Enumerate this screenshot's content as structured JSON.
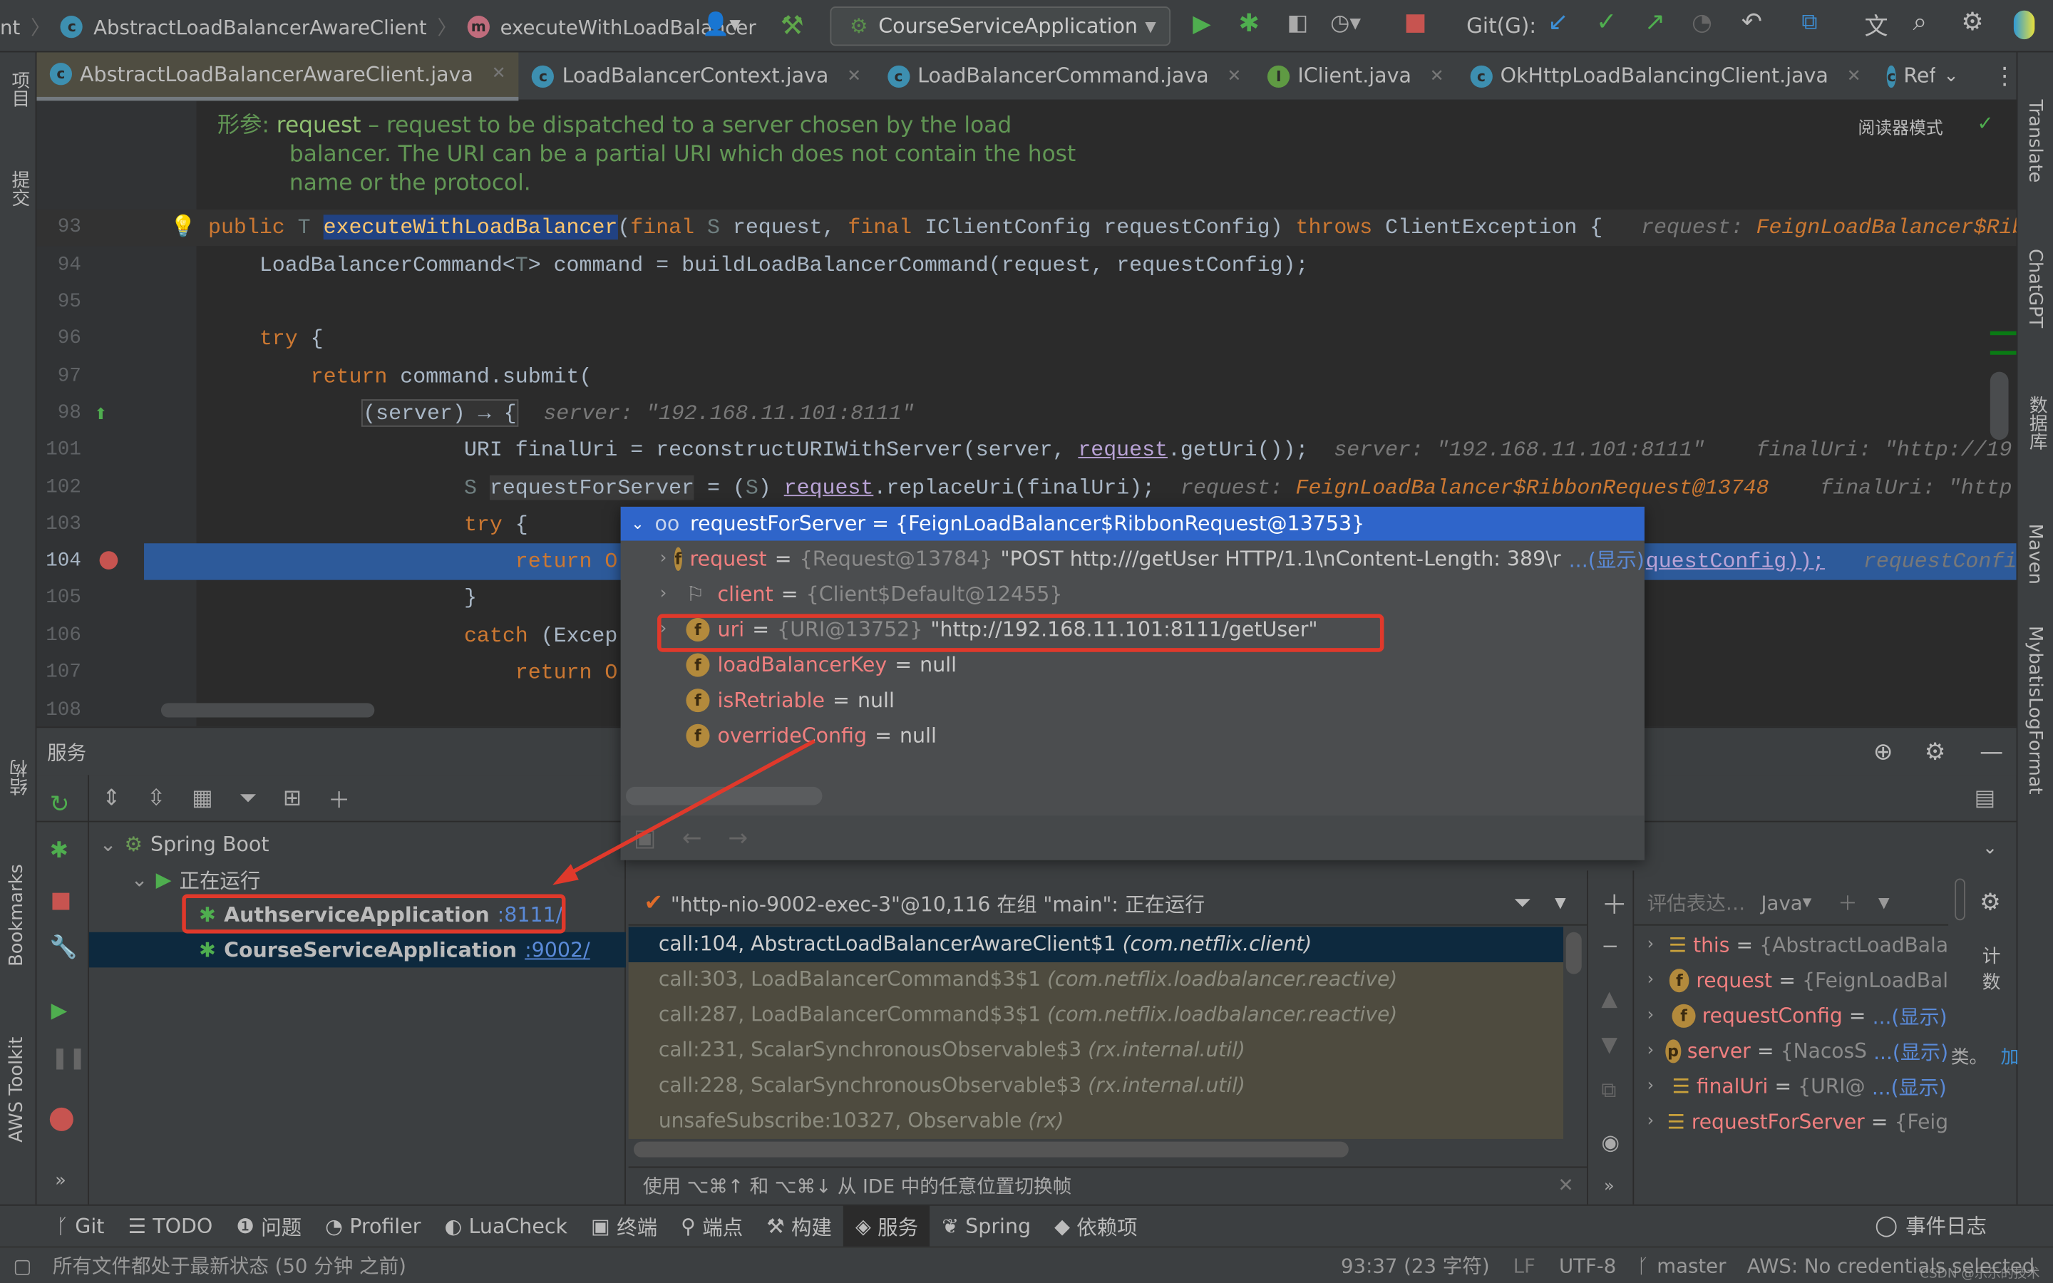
{
  "toolbar": {
    "breadcrumb": [
      "nt",
      "AbstractLoadBalancerAwareClient",
      "executeWithLoadBalancer"
    ],
    "run_config": "CourseServiceApplication",
    "git_label": "Git(G):"
  },
  "tabs": [
    {
      "label": "AbstractLoadBalancerAwareClient.java",
      "icon": "C",
      "active": true
    },
    {
      "label": "LoadBalancerContext.java",
      "icon": "C"
    },
    {
      "label": "LoadBalancerCommand.java",
      "icon": "C"
    },
    {
      "label": "IClient.java",
      "icon": "I"
    },
    {
      "label": "OkHttpLoadBalancingClient.java",
      "icon": "C"
    },
    {
      "label": "ReflectiveFeign",
      "icon": "C"
    }
  ],
  "left_stripe": {
    "project": "项目",
    "commit": "提交",
    "structure": "结构",
    "bookmarks": "Bookmarks",
    "aws": "AWS Toolkit"
  },
  "right_stripe": {
    "translate": "Translate",
    "chatgpt": "ChatGPT",
    "database": "数据库",
    "maven": "Maven",
    "mybatis": "MybatisLogFormat"
  },
  "editor": {
    "reader_mode": "阅读器模式",
    "doc": {
      "label": "形参:",
      "param": "request",
      "line1": " – request to be dispatched to a server chosen by the load",
      "line2": "balancer. The URI can be a partial URI which does not contain the host",
      "line3": "name or the protocol."
    },
    "lines": [
      {
        "n": "93",
        "t": [
          [
            "public ",
            "k"
          ],
          [
            "T ",
            "tp"
          ],
          [
            "executeWithLoadBalancer",
            "mh"
          ],
          [
            "(",
            ""
          ],
          [
            "final ",
            "k"
          ],
          [
            "S ",
            "tp"
          ],
          [
            "request, ",
            ""
          ],
          [
            "final ",
            "k"
          ],
          [
            "IClientConfig requestConfig) ",
            ""
          ],
          [
            "throws ",
            "k"
          ],
          [
            "ClientException {",
            ""
          ],
          [
            "   request: ",
            "hint"
          ],
          [
            "FeignLoadBalancer$Ribbo",
            "hinto"
          ]
        ]
      },
      {
        "n": "94",
        "t": [
          [
            "    LoadBalancerCommand<",
            ""
          ],
          [
            "T",
            "tp"
          ],
          [
            "> command = buildLoadBalancerCommand(request, requestConfig);",
            ""
          ]
        ]
      },
      {
        "n": "95",
        "t": []
      },
      {
        "n": "96",
        "t": [
          [
            "    ",
            ""
          ],
          [
            "try ",
            "k"
          ],
          [
            "{",
            ""
          ]
        ]
      },
      {
        "n": "97",
        "t": [
          [
            "        ",
            ""
          ],
          [
            "return ",
            "k"
          ],
          [
            "command.submit(",
            ""
          ]
        ]
      },
      {
        "n": "98",
        "t": [
          [
            "            ",
            ""
          ],
          [
            "(server) → {",
            "lb"
          ],
          [
            "  server: \"192.168.11.101:8111\"",
            "hint"
          ]
        ]
      },
      {
        "n": "101",
        "t": [
          [
            "                    URI finalUri = reconstructURIWithServer(server, ",
            ""
          ],
          [
            "request",
            "ul"
          ],
          [
            ".getUri());",
            ""
          ],
          [
            "  server: \"192.168.11.101:8111\"    finalUri: \"http://19",
            "hint"
          ]
        ]
      },
      {
        "n": "102",
        "t": [
          [
            "                    ",
            ""
          ],
          [
            "S ",
            "tp"
          ],
          [
            "requestForServer",
            "hv"
          ],
          [
            " = (",
            ""
          ],
          [
            "S",
            "tp"
          ],
          [
            ") ",
            ""
          ],
          [
            "request",
            "ul"
          ],
          [
            ".replaceUri(finalUri);",
            ""
          ],
          [
            "  request: ",
            "hint"
          ],
          [
            "FeignLoadBalancer$RibbonRequest@13748",
            "hinto"
          ],
          [
            "    finalUri: \"http",
            "hint"
          ]
        ]
      },
      {
        "n": "103",
        "t": [
          [
            "                    ",
            ""
          ],
          [
            "try ",
            "k"
          ],
          [
            "{",
            ""
          ]
        ]
      },
      {
        "n": "104",
        "t": [
          [
            "                        ",
            ""
          ],
          [
            "return O",
            "k"
          ]
        ]
      },
      {
        "n": "105",
        "t": [
          [
            "                    }",
            ""
          ]
        ]
      },
      {
        "n": "106",
        "t": [
          [
            "                    ",
            ""
          ],
          [
            "catch ",
            "k"
          ],
          [
            "(Excep",
            ""
          ]
        ]
      },
      {
        "n": "107",
        "t": [
          [
            "                        ",
            ""
          ],
          [
            "return O",
            "k"
          ]
        ]
      },
      {
        "n": "108",
        "t": []
      }
    ],
    "line104_tail": "questConfig));",
    "line104_hint": "requestConfig"
  },
  "popup": {
    "header": "requestForServer = {FeignLoadBalancer$RibbonRequest@13753}",
    "rows": [
      {
        "name": "request",
        "ref": "{Request@13784}",
        "val": "\"POST http:///getUser HTTP/1.1\\nContent-Length: 389\\r",
        "more": "...(显示)",
        "expand": true,
        "icon": "f"
      },
      {
        "name": "client",
        "ref": "{Client$Default@12455}",
        "val": "",
        "more": "",
        "expand": true,
        "icon": "flag"
      },
      {
        "name": "uri",
        "ref": "{URI@13752}",
        "val": "\"http://192.168.11.101:8111/getUser\"",
        "more": "",
        "expand": true,
        "icon": "f"
      },
      {
        "name": "loadBalancerKey",
        "ref": "",
        "val": "null",
        "more": "",
        "expand": false,
        "icon": "f"
      },
      {
        "name": "isRetriable",
        "ref": "",
        "val": "null",
        "more": "",
        "expand": false,
        "icon": "f"
      },
      {
        "name": "overrideConfig",
        "ref": "",
        "val": "null",
        "more": "",
        "expand": false,
        "icon": "f"
      }
    ]
  },
  "services": {
    "title": "服务",
    "tree": [
      {
        "label": "Spring Boot"
      },
      {
        "label": "正在运行"
      },
      {
        "label": "AuthserviceApplication",
        "port": ":8111/"
      },
      {
        "label": "CourseServiceApplication",
        "port": ":9002/"
      }
    ]
  },
  "debugger": {
    "thread": "\"http-nio-9002-exec-3\"@10,116 在组 \"main\": 正在运行",
    "frames": [
      {
        "m": "call:104, AbstractLoadBalancerAwareClient$1",
        "p": "(com.netflix.client)"
      },
      {
        "m": "call:303, LoadBalancerCommand$3$1",
        "p": "(com.netflix.loadbalancer.reactive)"
      },
      {
        "m": "call:287, LoadBalancerCommand$3$1",
        "p": "(com.netflix.loadbalancer.reactive)"
      },
      {
        "m": "call:231, ScalarSynchronousObservable$3",
        "p": "(rx.internal.util)"
      },
      {
        "m": "call:228, ScalarSynchronousObservable$3",
        "p": "(rx.internal.util)"
      },
      {
        "m": "unsafeSubscribe:10327, Observable",
        "p": "(rx)"
      }
    ],
    "hint": "使用 ⌥⌘↑ 和 ⌥⌘↓ 从 IDE 中的任意位置切换帧",
    "eval_placeholder": "评估表达…",
    "eval_lang": "Java",
    "counter_label": "计数",
    "vars": [
      {
        "name": "this",
        "val": "{AbstractLoadBala",
        "more": "",
        "icon": "list"
      },
      {
        "name": "request",
        "val": "{FeignLoadBal",
        "more": "",
        "icon": "f"
      },
      {
        "name": "requestConfig",
        "val": "",
        "more": "...(显示)",
        "icon": "f"
      },
      {
        "name": "server",
        "val": "{NacosS",
        "more": "...(显示)",
        "icon": "p"
      },
      {
        "name": "finalUri",
        "val": "{URI@",
        "more": "...(显示)",
        "icon": "list"
      },
      {
        "name": "requestForServer",
        "val": "{Feig",
        "more": "",
        "icon": "list"
      }
    ],
    "overflow_text": "类。",
    "overflow_link": "加"
  },
  "bottom_tools": [
    {
      "label": "Git",
      "icon": "branch-icon"
    },
    {
      "label": "TODO",
      "icon": "list-icon"
    },
    {
      "label": "问题",
      "icon": "info-icon"
    },
    {
      "label": "Profiler",
      "icon": "profiler-icon"
    },
    {
      "label": "LuaCheck",
      "icon": "luacheck-icon"
    },
    {
      "label": "终端",
      "icon": "terminal-icon"
    },
    {
      "label": "端点",
      "icon": "endpoints-icon"
    },
    {
      "label": "构建",
      "icon": "build-icon"
    },
    {
      "label": "服务",
      "icon": "services-icon",
      "active": true
    },
    {
      "label": "Spring",
      "icon": "spring-icon"
    },
    {
      "label": "依赖项",
      "icon": "dependencies-icon"
    }
  ],
  "event_log": "事件日志",
  "status": {
    "left": "所有文件都处于最新状态 (50 分钟 之前)",
    "position": "93:37 (23 字符)",
    "line_sep": "LF",
    "encoding": "UTF-8",
    "branch": "master",
    "aws": "AWS: No credentials selected",
    "watermark": "CSDN @乐乐的技术"
  },
  "colors": {
    "accent": "#2f65ca",
    "selection": "#0d293e",
    "annotation": "#e0392b",
    "breakpoint_line": "#2d5a9a"
  }
}
